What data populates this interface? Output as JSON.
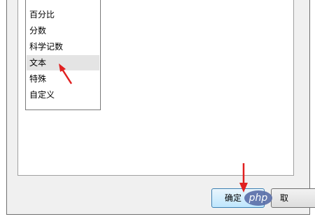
{
  "format_list": {
    "items": [
      "百分比",
      "分数",
      "科学记数",
      "文本",
      "特殊",
      "自定义"
    ],
    "selected": "文本"
  },
  "buttons": {
    "ok_label": "确定",
    "cancel_label": "取"
  },
  "watermark": {
    "text": "php"
  },
  "colors": {
    "annotation_arrow": "#e02020",
    "selected_row": "#e4e4e4"
  }
}
